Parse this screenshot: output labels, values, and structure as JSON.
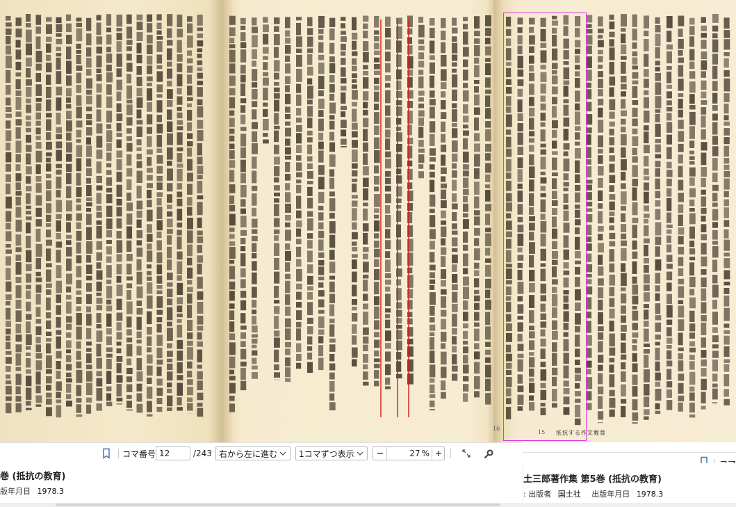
{
  "scan": {
    "page_left_number": "",
    "page_mid_number": "16",
    "page_right_number": "15",
    "running_head": "抵抗する作文教育"
  },
  "toolbar": {
    "frame_label": "コマ番号",
    "frame_value": "12",
    "frame_total": "/243",
    "direction": "右から左に進む",
    "display_mode": "1コマずつ表示",
    "zoom": "27",
    "zoom_unit": "%",
    "right_frame_label": "コマ"
  },
  "footer_left": {
    "title": "巻 (抵抗の教育)",
    "meta_label": "版年月日",
    "meta_value": "1978.3"
  },
  "footer_right": {
    "title": "土三郎著作集 第5巻 (抵抗の教育)",
    "publisher_label": ": 出版者",
    "publisher_value": "国土社",
    "date_label": "出版年月日",
    "date_value": "1978.3"
  },
  "colors": {
    "highlight_box": "#e032e8",
    "underline": "#d01b1b",
    "paper": "#f4e8cb"
  }
}
